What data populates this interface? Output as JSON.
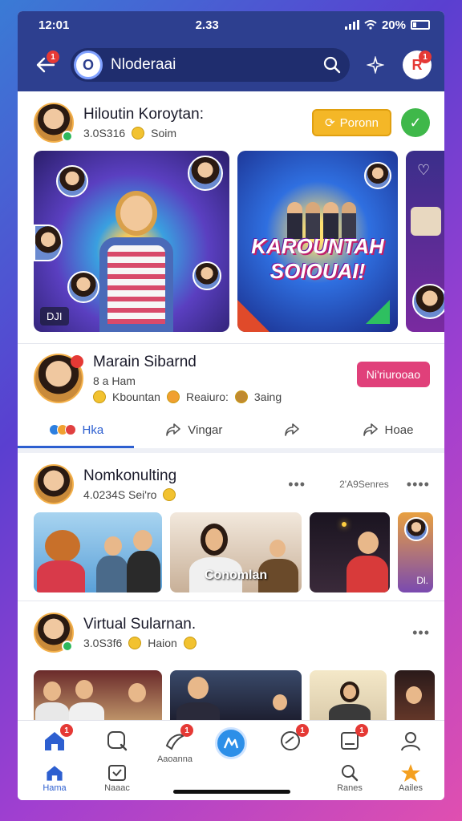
{
  "status": {
    "time": "12:01",
    "center": "2.33",
    "battery": "20%"
  },
  "topbar": {
    "back_badge": "1",
    "search_text": "Nloderaai",
    "avatar_badge": "1"
  },
  "post1": {
    "name": "Hiloutin Koroytan:",
    "stats": "3.0S316",
    "reaction": "Soim",
    "primary_button": "Poronn",
    "stories": [
      {
        "tag": "DJI"
      },
      {
        "title": "KAROUNTAH SOIOUAI!"
      },
      {
        "tag": ""
      }
    ]
  },
  "post2": {
    "name": "Marain Sibarnd",
    "line1": "8 a Ham",
    "chip1": "Kbountan",
    "chip2": "Reaiuro:",
    "chip3": "3aing",
    "button": "Ni'riurooao",
    "actions": {
      "like": "Hka",
      "share1": "Vingar",
      "share3": "Hoae"
    }
  },
  "post3": {
    "name": "Nomkonulting",
    "stats": "4.0234S Sei'ro",
    "center_text": "2'A9Senres",
    "photos": [
      {
        "label": ""
      },
      {
        "label": "Conomlan"
      },
      {
        "label": ""
      },
      {
        "label": "Dl."
      }
    ]
  },
  "post4": {
    "name": "Virtual Sularnan.",
    "stats": "3.0S3f6",
    "reaction": "Haion"
  },
  "tabbar": {
    "top_badges": [
      "1",
      "1",
      "1",
      "1"
    ],
    "middle_label": "Aaoanna",
    "home_label": "Hama",
    "tab2_label": "Naaac",
    "tab4_label": "Ranes",
    "tab5_label": "Aailes"
  },
  "colors": {
    "primary": "#2d3f8f",
    "accent_yellow": "#f4b727",
    "accent_pink": "#e0407a",
    "accent_green": "#3fb84a",
    "badge": "#e53935"
  }
}
